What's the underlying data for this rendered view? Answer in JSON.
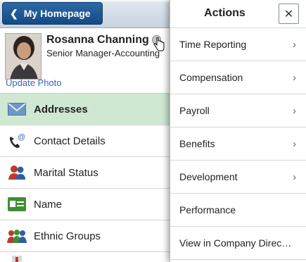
{
  "header": {
    "home_label": "My Homepage"
  },
  "profile": {
    "name": "Rosanna Channing",
    "title": "Senior Manager-Accounting",
    "update_photo": "Update Photo"
  },
  "left_menu": [
    {
      "label": "Addresses",
      "icon": "envelope-icon",
      "active": true
    },
    {
      "label": "Contact Details",
      "icon": "phone-icon"
    },
    {
      "label": "Marital Status",
      "icon": "people-icon"
    },
    {
      "label": "Name",
      "icon": "id-card-icon"
    },
    {
      "label": "Ethnic Groups",
      "icon": "group-icon"
    }
  ],
  "actions": {
    "title": "Actions",
    "close_icon": "close-icon",
    "items": [
      {
        "label": "Time Reporting",
        "has_submenu": true
      },
      {
        "label": "Compensation",
        "has_submenu": true
      },
      {
        "label": "Payroll",
        "has_submenu": true
      },
      {
        "label": "Benefits",
        "has_submenu": true
      },
      {
        "label": "Development",
        "has_submenu": true
      },
      {
        "label": "Performance",
        "has_submenu": false
      },
      {
        "label": "View in Company Direc…",
        "has_submenu": false
      }
    ]
  },
  "colors": {
    "active_row": "#cfe8d2",
    "link": "#3b64b8",
    "home_button": "#1d5592"
  }
}
